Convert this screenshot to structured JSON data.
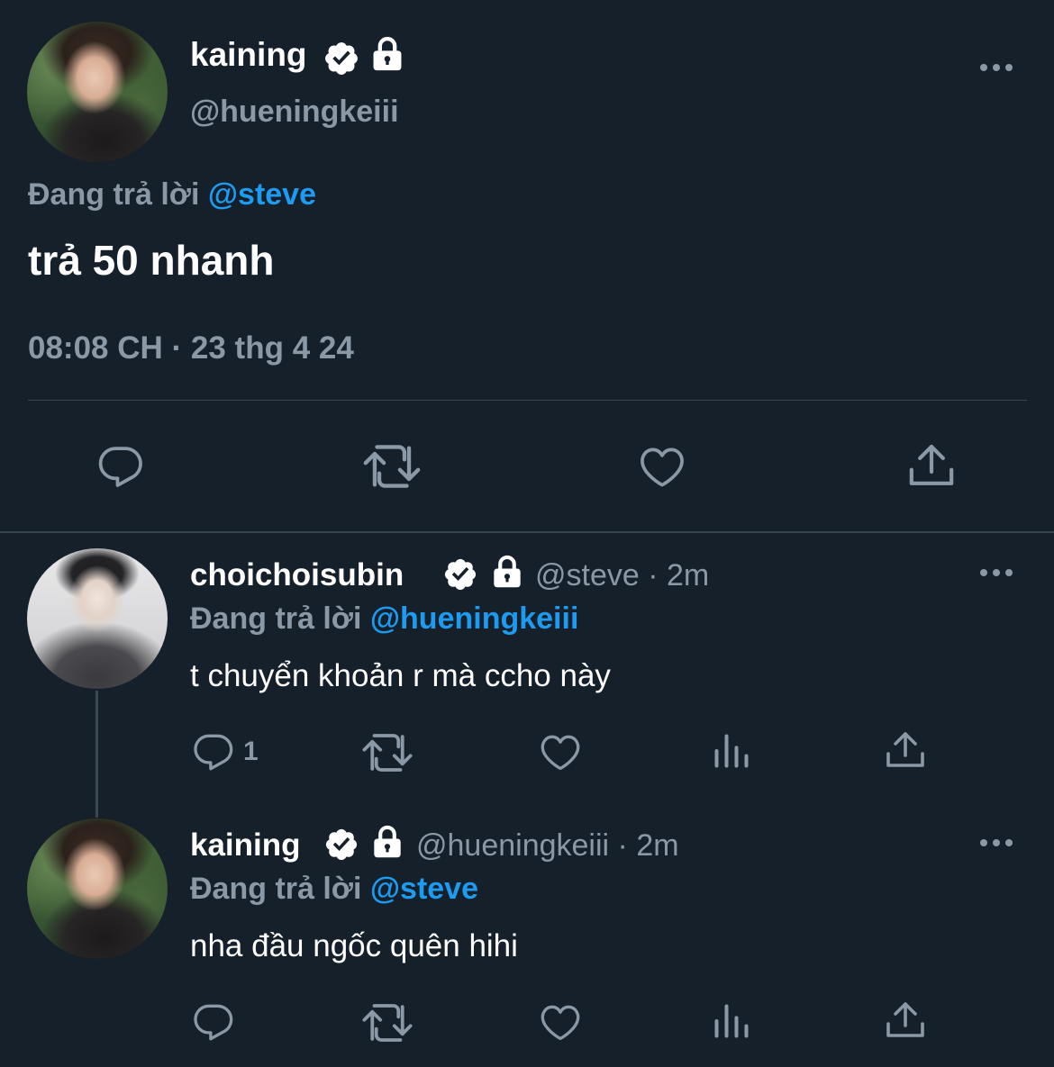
{
  "main_tweet": {
    "author": {
      "display_name": "kaining",
      "handle": "@hueningkeiii"
    },
    "replying_to_prefix": "Đang trả lời",
    "replying_to": "@steve",
    "text": "trả 50 nhanh",
    "timestamp": "08:08 CH · 23 thg 4 24",
    "icons": [
      "verified-badge-icon",
      "lock-icon",
      "more-icon",
      "reply-icon",
      "retweet-icon",
      "like-icon",
      "share-icon"
    ]
  },
  "replies": [
    {
      "display_name": "choichoisubin",
      "handle": "@steve",
      "time_meta": "· 2m",
      "replying_to_prefix": "Đang trả lời",
      "replying_to": "@hueningkeiii",
      "text": "t chuyển khoản r mà ccho này",
      "reply_count": "1",
      "icons": [
        "verified-badge-icon",
        "lock-icon",
        "more-icon",
        "reply-icon",
        "retweet-icon",
        "like-icon",
        "analytics-icon",
        "share-icon"
      ]
    },
    {
      "display_name": "kaining",
      "handle": "@hueningkeiii",
      "time_meta": "· 2m",
      "replying_to_prefix": "Đang trả lời",
      "replying_to": "@steve",
      "text": "nha đầu ngốc quên hihi",
      "icons": [
        "verified-badge-icon",
        "lock-icon",
        "more-icon",
        "reply-icon",
        "retweet-icon",
        "like-icon",
        "analytics-icon",
        "share-icon"
      ]
    }
  ],
  "colors": {
    "background": "#15202b",
    "text_primary": "#ffffff",
    "text_secondary": "#8b98a5",
    "accent": "#1d9bf0",
    "divider": "#38444d"
  }
}
